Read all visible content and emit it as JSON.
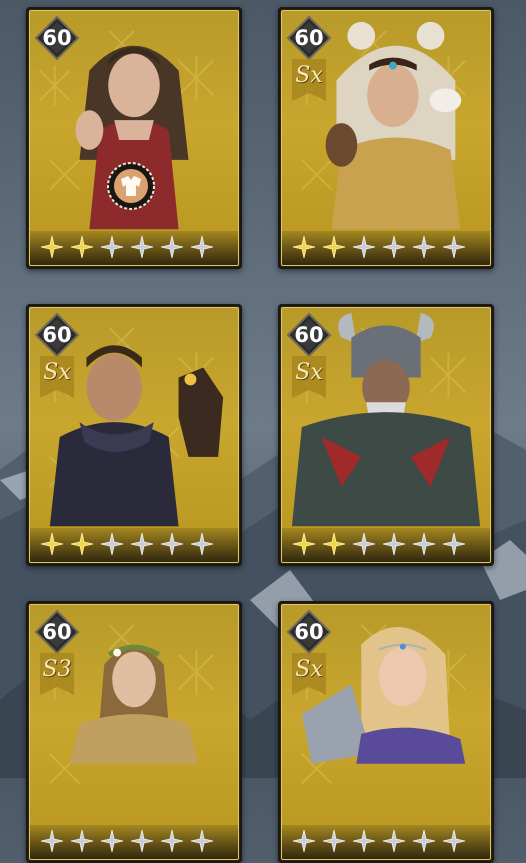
{
  "heroes": [
    {
      "level": "60",
      "rank": "",
      "stars_filled": 2,
      "stars_total": 6,
      "has_skill_emblem": true,
      "portrait": "woman-red-dress"
    },
    {
      "level": "60",
      "rank": "Sx",
      "stars_filled": 2,
      "stars_total": 6,
      "has_skill_emblem": false,
      "portrait": "woman-bear-hood"
    },
    {
      "level": "60",
      "rank": "Sx",
      "stars_filled": 2,
      "stars_total": 6,
      "has_skill_emblem": false,
      "portrait": "man-with-falcon"
    },
    {
      "level": "60",
      "rank": "Sx",
      "stars_filled": 2,
      "stars_total": 6,
      "has_skill_emblem": false,
      "portrait": "armored-horned-warrior"
    },
    {
      "level": "60",
      "rank": "S3",
      "stars_filled": 0,
      "stars_total": 6,
      "has_skill_emblem": false,
      "portrait": "woman-laurel-wreath"
    },
    {
      "level": "60",
      "rank": "Sx",
      "stars_filled": 0,
      "stars_total": 6,
      "has_skill_emblem": false,
      "portrait": "woman-blonde-armor"
    }
  ],
  "colors": {
    "card_gold": "#c9a62e",
    "star_gold": "#f2d34a",
    "star_silver": "#c9ccd2",
    "badge_dark": "#2a2a2a"
  },
  "icons": {
    "level_badge": "diamond-badge-icon",
    "rank_banner": "rank-banner-icon",
    "star": "star-icon",
    "skill_emblem": "armor-skill-icon"
  }
}
